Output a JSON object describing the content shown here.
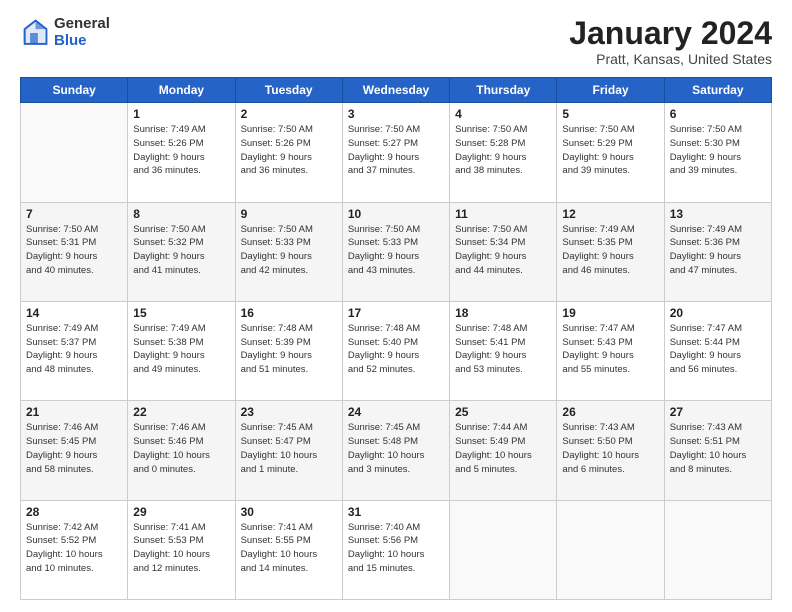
{
  "header": {
    "logo_general": "General",
    "logo_blue": "Blue",
    "title": "January 2024",
    "subtitle": "Pratt, Kansas, United States"
  },
  "columns": [
    "Sunday",
    "Monday",
    "Tuesday",
    "Wednesday",
    "Thursday",
    "Friday",
    "Saturday"
  ],
  "weeks": [
    [
      {
        "day": "",
        "info": ""
      },
      {
        "day": "1",
        "info": "Sunrise: 7:49 AM\nSunset: 5:26 PM\nDaylight: 9 hours\nand 36 minutes."
      },
      {
        "day": "2",
        "info": "Sunrise: 7:50 AM\nSunset: 5:26 PM\nDaylight: 9 hours\nand 36 minutes."
      },
      {
        "day": "3",
        "info": "Sunrise: 7:50 AM\nSunset: 5:27 PM\nDaylight: 9 hours\nand 37 minutes."
      },
      {
        "day": "4",
        "info": "Sunrise: 7:50 AM\nSunset: 5:28 PM\nDaylight: 9 hours\nand 38 minutes."
      },
      {
        "day": "5",
        "info": "Sunrise: 7:50 AM\nSunset: 5:29 PM\nDaylight: 9 hours\nand 39 minutes."
      },
      {
        "day": "6",
        "info": "Sunrise: 7:50 AM\nSunset: 5:30 PM\nDaylight: 9 hours\nand 39 minutes."
      }
    ],
    [
      {
        "day": "7",
        "info": "Sunrise: 7:50 AM\nSunset: 5:31 PM\nDaylight: 9 hours\nand 40 minutes."
      },
      {
        "day": "8",
        "info": "Sunrise: 7:50 AM\nSunset: 5:32 PM\nDaylight: 9 hours\nand 41 minutes."
      },
      {
        "day": "9",
        "info": "Sunrise: 7:50 AM\nSunset: 5:33 PM\nDaylight: 9 hours\nand 42 minutes."
      },
      {
        "day": "10",
        "info": "Sunrise: 7:50 AM\nSunset: 5:33 PM\nDaylight: 9 hours\nand 43 minutes."
      },
      {
        "day": "11",
        "info": "Sunrise: 7:50 AM\nSunset: 5:34 PM\nDaylight: 9 hours\nand 44 minutes."
      },
      {
        "day": "12",
        "info": "Sunrise: 7:49 AM\nSunset: 5:35 PM\nDaylight: 9 hours\nand 46 minutes."
      },
      {
        "day": "13",
        "info": "Sunrise: 7:49 AM\nSunset: 5:36 PM\nDaylight: 9 hours\nand 47 minutes."
      }
    ],
    [
      {
        "day": "14",
        "info": "Sunrise: 7:49 AM\nSunset: 5:37 PM\nDaylight: 9 hours\nand 48 minutes."
      },
      {
        "day": "15",
        "info": "Sunrise: 7:49 AM\nSunset: 5:38 PM\nDaylight: 9 hours\nand 49 minutes."
      },
      {
        "day": "16",
        "info": "Sunrise: 7:48 AM\nSunset: 5:39 PM\nDaylight: 9 hours\nand 51 minutes."
      },
      {
        "day": "17",
        "info": "Sunrise: 7:48 AM\nSunset: 5:40 PM\nDaylight: 9 hours\nand 52 minutes."
      },
      {
        "day": "18",
        "info": "Sunrise: 7:48 AM\nSunset: 5:41 PM\nDaylight: 9 hours\nand 53 minutes."
      },
      {
        "day": "19",
        "info": "Sunrise: 7:47 AM\nSunset: 5:43 PM\nDaylight: 9 hours\nand 55 minutes."
      },
      {
        "day": "20",
        "info": "Sunrise: 7:47 AM\nSunset: 5:44 PM\nDaylight: 9 hours\nand 56 minutes."
      }
    ],
    [
      {
        "day": "21",
        "info": "Sunrise: 7:46 AM\nSunset: 5:45 PM\nDaylight: 9 hours\nand 58 minutes."
      },
      {
        "day": "22",
        "info": "Sunrise: 7:46 AM\nSunset: 5:46 PM\nDaylight: 10 hours\nand 0 minutes."
      },
      {
        "day": "23",
        "info": "Sunrise: 7:45 AM\nSunset: 5:47 PM\nDaylight: 10 hours\nand 1 minute."
      },
      {
        "day": "24",
        "info": "Sunrise: 7:45 AM\nSunset: 5:48 PM\nDaylight: 10 hours\nand 3 minutes."
      },
      {
        "day": "25",
        "info": "Sunrise: 7:44 AM\nSunset: 5:49 PM\nDaylight: 10 hours\nand 5 minutes."
      },
      {
        "day": "26",
        "info": "Sunrise: 7:43 AM\nSunset: 5:50 PM\nDaylight: 10 hours\nand 6 minutes."
      },
      {
        "day": "27",
        "info": "Sunrise: 7:43 AM\nSunset: 5:51 PM\nDaylight: 10 hours\nand 8 minutes."
      }
    ],
    [
      {
        "day": "28",
        "info": "Sunrise: 7:42 AM\nSunset: 5:52 PM\nDaylight: 10 hours\nand 10 minutes."
      },
      {
        "day": "29",
        "info": "Sunrise: 7:41 AM\nSunset: 5:53 PM\nDaylight: 10 hours\nand 12 minutes."
      },
      {
        "day": "30",
        "info": "Sunrise: 7:41 AM\nSunset: 5:55 PM\nDaylight: 10 hours\nand 14 minutes."
      },
      {
        "day": "31",
        "info": "Sunrise: 7:40 AM\nSunset: 5:56 PM\nDaylight: 10 hours\nand 15 minutes."
      },
      {
        "day": "",
        "info": ""
      },
      {
        "day": "",
        "info": ""
      },
      {
        "day": "",
        "info": ""
      }
    ]
  ]
}
